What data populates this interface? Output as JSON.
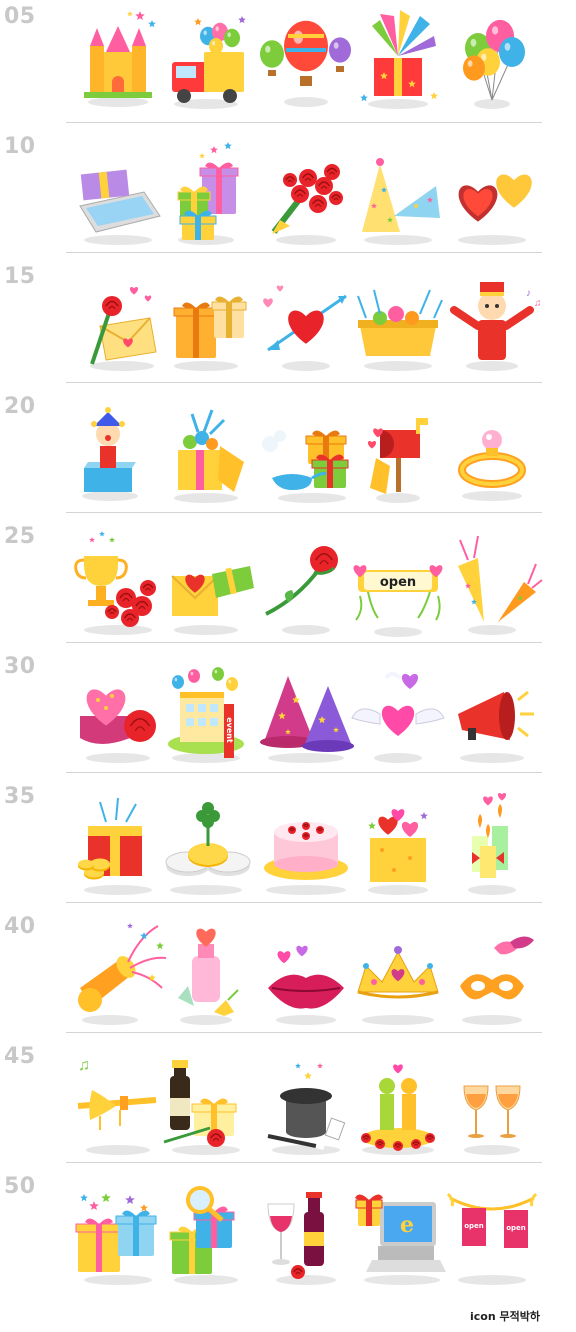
{
  "rows": [
    {
      "number": "05",
      "icons": [
        "castle-icon",
        "gift-truck-icon",
        "hot-air-balloons-icon",
        "surprise-gift-box-icon",
        "balloons-icon"
      ]
    },
    {
      "number": "10",
      "icons": [
        "gift-card-envelope-icon",
        "stacked-gifts-icon",
        "rose-bouquet-icon",
        "party-hats-icon",
        "heart-chocolate-box-icon"
      ]
    },
    {
      "number": "15",
      "icons": [
        "love-letter-rose-icon",
        "gift-boxes-icon",
        "heart-arrow-icon",
        "fruit-gift-basket-icon",
        "bellboy-icon"
      ]
    },
    {
      "number": "20",
      "icons": [
        "jack-in-the-box-icon",
        "open-gift-box-icon",
        "magic-lamp-gifts-icon",
        "mailbox-icon",
        "ring-icon"
      ]
    },
    {
      "number": "25",
      "icons": [
        "trophy-roses-icon",
        "envelope-gift-icon",
        "single-rose-icon",
        "open-sign-icon",
        "party-poppers-icon"
      ]
    },
    {
      "number": "30",
      "icons": [
        "heart-box-rose-icon",
        "event-building-icon",
        "wizard-hats-icon",
        "winged-heart-icon",
        "megaphone-icon"
      ]
    },
    {
      "number": "35",
      "icons": [
        "treasure-box-coins-icon",
        "clover-coins-icon",
        "cake-icon",
        "hearts-gift-box-icon",
        "candles-icon"
      ]
    },
    {
      "number": "40",
      "icons": [
        "confetti-cannon-icon",
        "heart-bottle-icon",
        "lips-icon",
        "tiara-icon",
        "masquerade-mask-icon"
      ]
    },
    {
      "number": "45",
      "icons": [
        "trumpet-icon",
        "wine-bottle-gift-icon",
        "magic-hat-icon",
        "couple-figures-icon",
        "wine-glasses-icon"
      ]
    },
    {
      "number": "50",
      "icons": [
        "gift-boxes-stars-icon",
        "magnifier-gift-icon",
        "wine-glass-bottle-icon",
        "laptop-gift-icon",
        "open-banner-flags-icon"
      ]
    }
  ],
  "labels": {
    "open_sign": "open",
    "event_sign": "event",
    "banner_flag": "open"
  },
  "footer": "icon 무적박하",
  "colors": {
    "row_number": "#c8c8c8",
    "divider": "#d4d4d4",
    "red": "#e8322a",
    "yellow": "#ffd23c",
    "orange": "#ff9a1f",
    "pink": "#ff6fa8",
    "purple": "#a06ad8",
    "blue": "#3fb2e8",
    "green": "#7ccc3c"
  }
}
